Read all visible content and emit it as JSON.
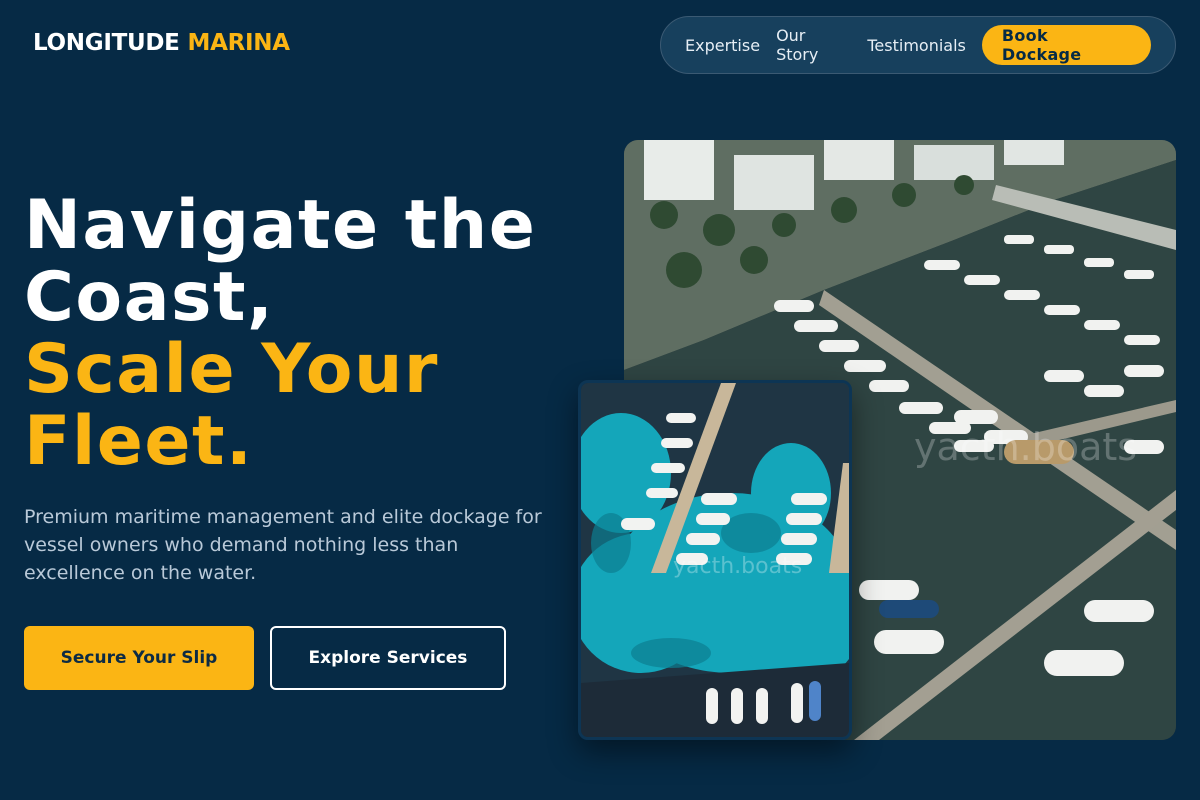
{
  "brand": {
    "name": "LONGITUDE",
    "accent": "MARINA"
  },
  "nav": {
    "links": [
      "Expertise",
      "Our Story",
      "Testimonials"
    ],
    "cta": "Book Dockage"
  },
  "hero": {
    "headline_line1": "Navigate the",
    "headline_line2": "Coast,",
    "headline_line3": "Scale Your",
    "headline_line4": "Fleet.",
    "subtext": "Premium maritime management and elite dockage for vessel owners who demand nothing less than excellence on the water.",
    "primary_button": "Secure Your Slip",
    "secondary_button": "Explore Services"
  },
  "images": {
    "main_watermark": "yacth.boats",
    "inset_watermark": "yacth.boats"
  },
  "colors": {
    "background": "#062a45",
    "accent": "#fbb514",
    "text": "#ffffff",
    "muted": "#b9c9d8"
  }
}
